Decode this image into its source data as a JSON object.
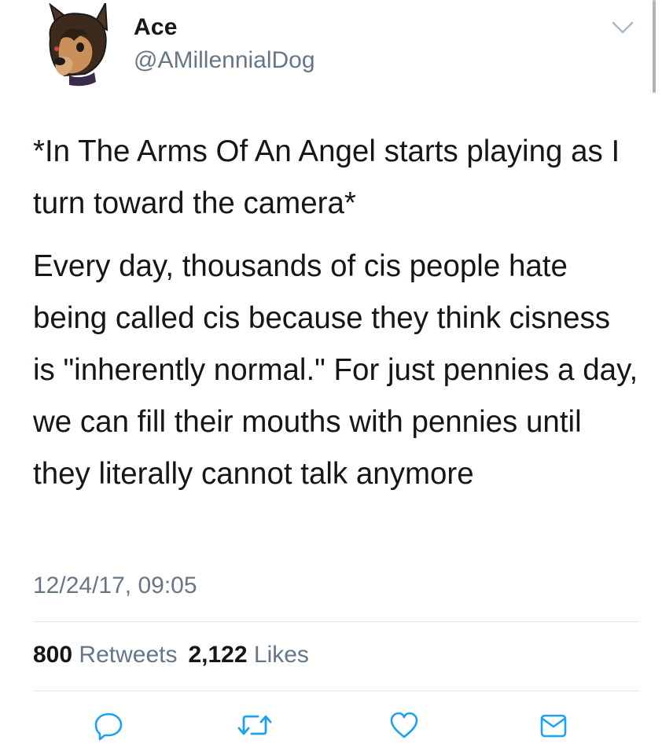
{
  "user": {
    "display_name": "Ace",
    "handle": "@AMillennialDog",
    "avatar_icon": "dog-avatar"
  },
  "tweet": {
    "lines_first": "*In The Arms Of An Angel starts playing as I turn toward the camera*",
    "lines_second": "Every day, thousands of cis people hate being called cis because they think cisness is \"inherently normal.\" For just pennies a day, we can fill their mouths with pennies until they literally cannot talk anymore",
    "timestamp": "12/24/17, 09:05"
  },
  "stats": {
    "retweets_count": "800",
    "retweets_label": "Retweets",
    "likes_count": "2,122",
    "likes_label": "Likes"
  },
  "actions": {
    "reply_icon": "reply-icon",
    "retweet_icon": "retweet-icon",
    "like_icon": "heart-icon",
    "dm_icon": "envelope-icon"
  },
  "colors": {
    "text": "#14171a",
    "secondary": "#657786",
    "accent": "#1da1f2",
    "divider": "#e1e8ed"
  }
}
